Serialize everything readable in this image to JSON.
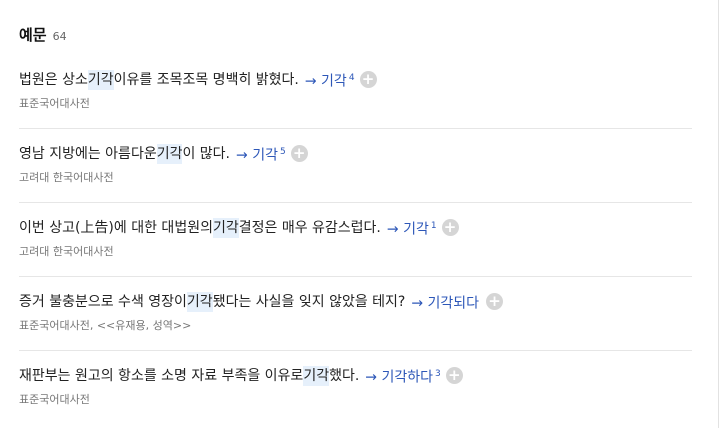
{
  "section": {
    "title": "예문",
    "count": "64"
  },
  "examples": [
    {
      "pre": "법원은 상소 ",
      "highlight": "기각",
      "post": " 이유를 조목조목 명백히 밝혔다.",
      "link": "→ 기각",
      "sup": "4",
      "source": "표준국어대사전"
    },
    {
      "pre": "영남 지방에는 아름다운 ",
      "highlight": "기각",
      "post": "이 많다.",
      "link": "→ 기각",
      "sup": "5",
      "source": "고려대 한국어대사전"
    },
    {
      "pre": "이번 상고(上告)에 대한 대법원의 ",
      "highlight": "기각",
      "post": " 결정은 매우 유감스럽다.",
      "link": "→ 기각",
      "sup": "1",
      "source": "고려대 한국어대사전"
    },
    {
      "pre": "증거 불충분으로 수색 영장이 ",
      "highlight": "기각",
      "post": "됐다는 사실을 잊지 않았을 테지?",
      "link": "→ 기각되다",
      "sup": "",
      "source": "표준국어대사전, <<유재용, 성역>>"
    },
    {
      "pre": "재판부는 원고의 항소를 소명 자료 부족을 이유로 ",
      "highlight": "기각",
      "post": "했다.",
      "link": "→ 기각하다",
      "sup": "3",
      "source": "표준국어대사전"
    }
  ],
  "icons": {
    "add": "plus-circle-icon"
  },
  "colors": {
    "link": "#2d57b8",
    "highlight": "#e6f0fb",
    "plus": "#d5d5d5"
  }
}
